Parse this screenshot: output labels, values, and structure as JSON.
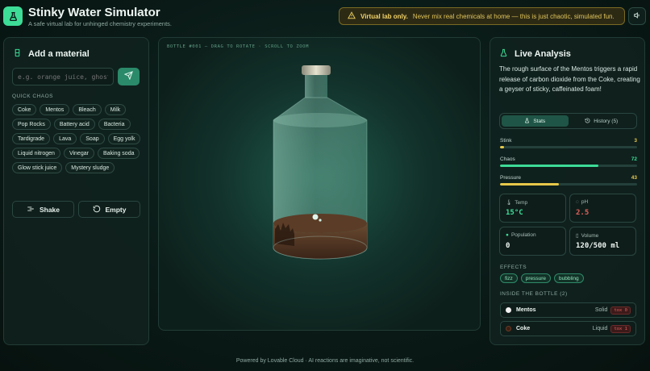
{
  "header": {
    "title": "Stinky Water Simulator",
    "subtitle": "A safe virtual lab for unhinged chemistry experiments.",
    "warning_bold": "Virtual lab only.",
    "warning_text": "Never mix real chemicals at home — this is just chaotic, simulated fun.",
    "warning_color": "#e0c55c"
  },
  "left": {
    "title": "Add a material",
    "input_placeholder": "e.g. orange juice, ghost",
    "quick_label": "QUICK CHAOS",
    "chips": [
      "Coke",
      "Mentos",
      "Bleach",
      "Milk",
      "Pop Rocks",
      "Battery acid",
      "Bacteria",
      "Tardigrade",
      "Lava",
      "Soap",
      "Egg yolk",
      "Liquid nitrogen",
      "Vinegar",
      "Baking soda",
      "Glow stick juice",
      "Mystery sludge"
    ],
    "shake_label": "Shake",
    "empty_label": "Empty"
  },
  "center": {
    "hint": "BOTTLE #001 — DRAG TO ROTATE · SCROLL TO ZOOM"
  },
  "right": {
    "title": "Live Analysis",
    "text": "The rough surface of the Mentos triggers a rapid release of carbon dioxide from the Coke, creating a geyser of sticky, caffeinated foam!",
    "tab_stats": "Stats",
    "tab_history": "History (5)",
    "stats": [
      {
        "label": "Stink",
        "value": 3,
        "color": "#e6c84a"
      },
      {
        "label": "Chaos",
        "value": 72,
        "color": "#3ddc97"
      },
      {
        "label": "Pressure",
        "value": 43,
        "color": "#e6c84a"
      }
    ],
    "temp_label": "Temp",
    "temp_value": "15°C",
    "ph_label": "pH",
    "ph_value": "2.5",
    "population_label": "Population",
    "population_value": "0",
    "volume_label": "Volume",
    "volume_value": "120/500 ml",
    "effects_label": "EFFECTS",
    "effects": [
      "fizz",
      "pressure",
      "bubbling"
    ],
    "inside_label": "INSIDE THE BOTTLE (2)",
    "items": [
      {
        "name": "Mentos",
        "state": "Solid",
        "tox": "tox 0",
        "color": "#f2f2f2"
      },
      {
        "name": "Coke",
        "state": "Liquid",
        "tox": "tox 1",
        "color": "#3a1f14"
      }
    ]
  },
  "footer": "Powered by Lovable Cloud · AI reactions are imaginative, not scientific."
}
